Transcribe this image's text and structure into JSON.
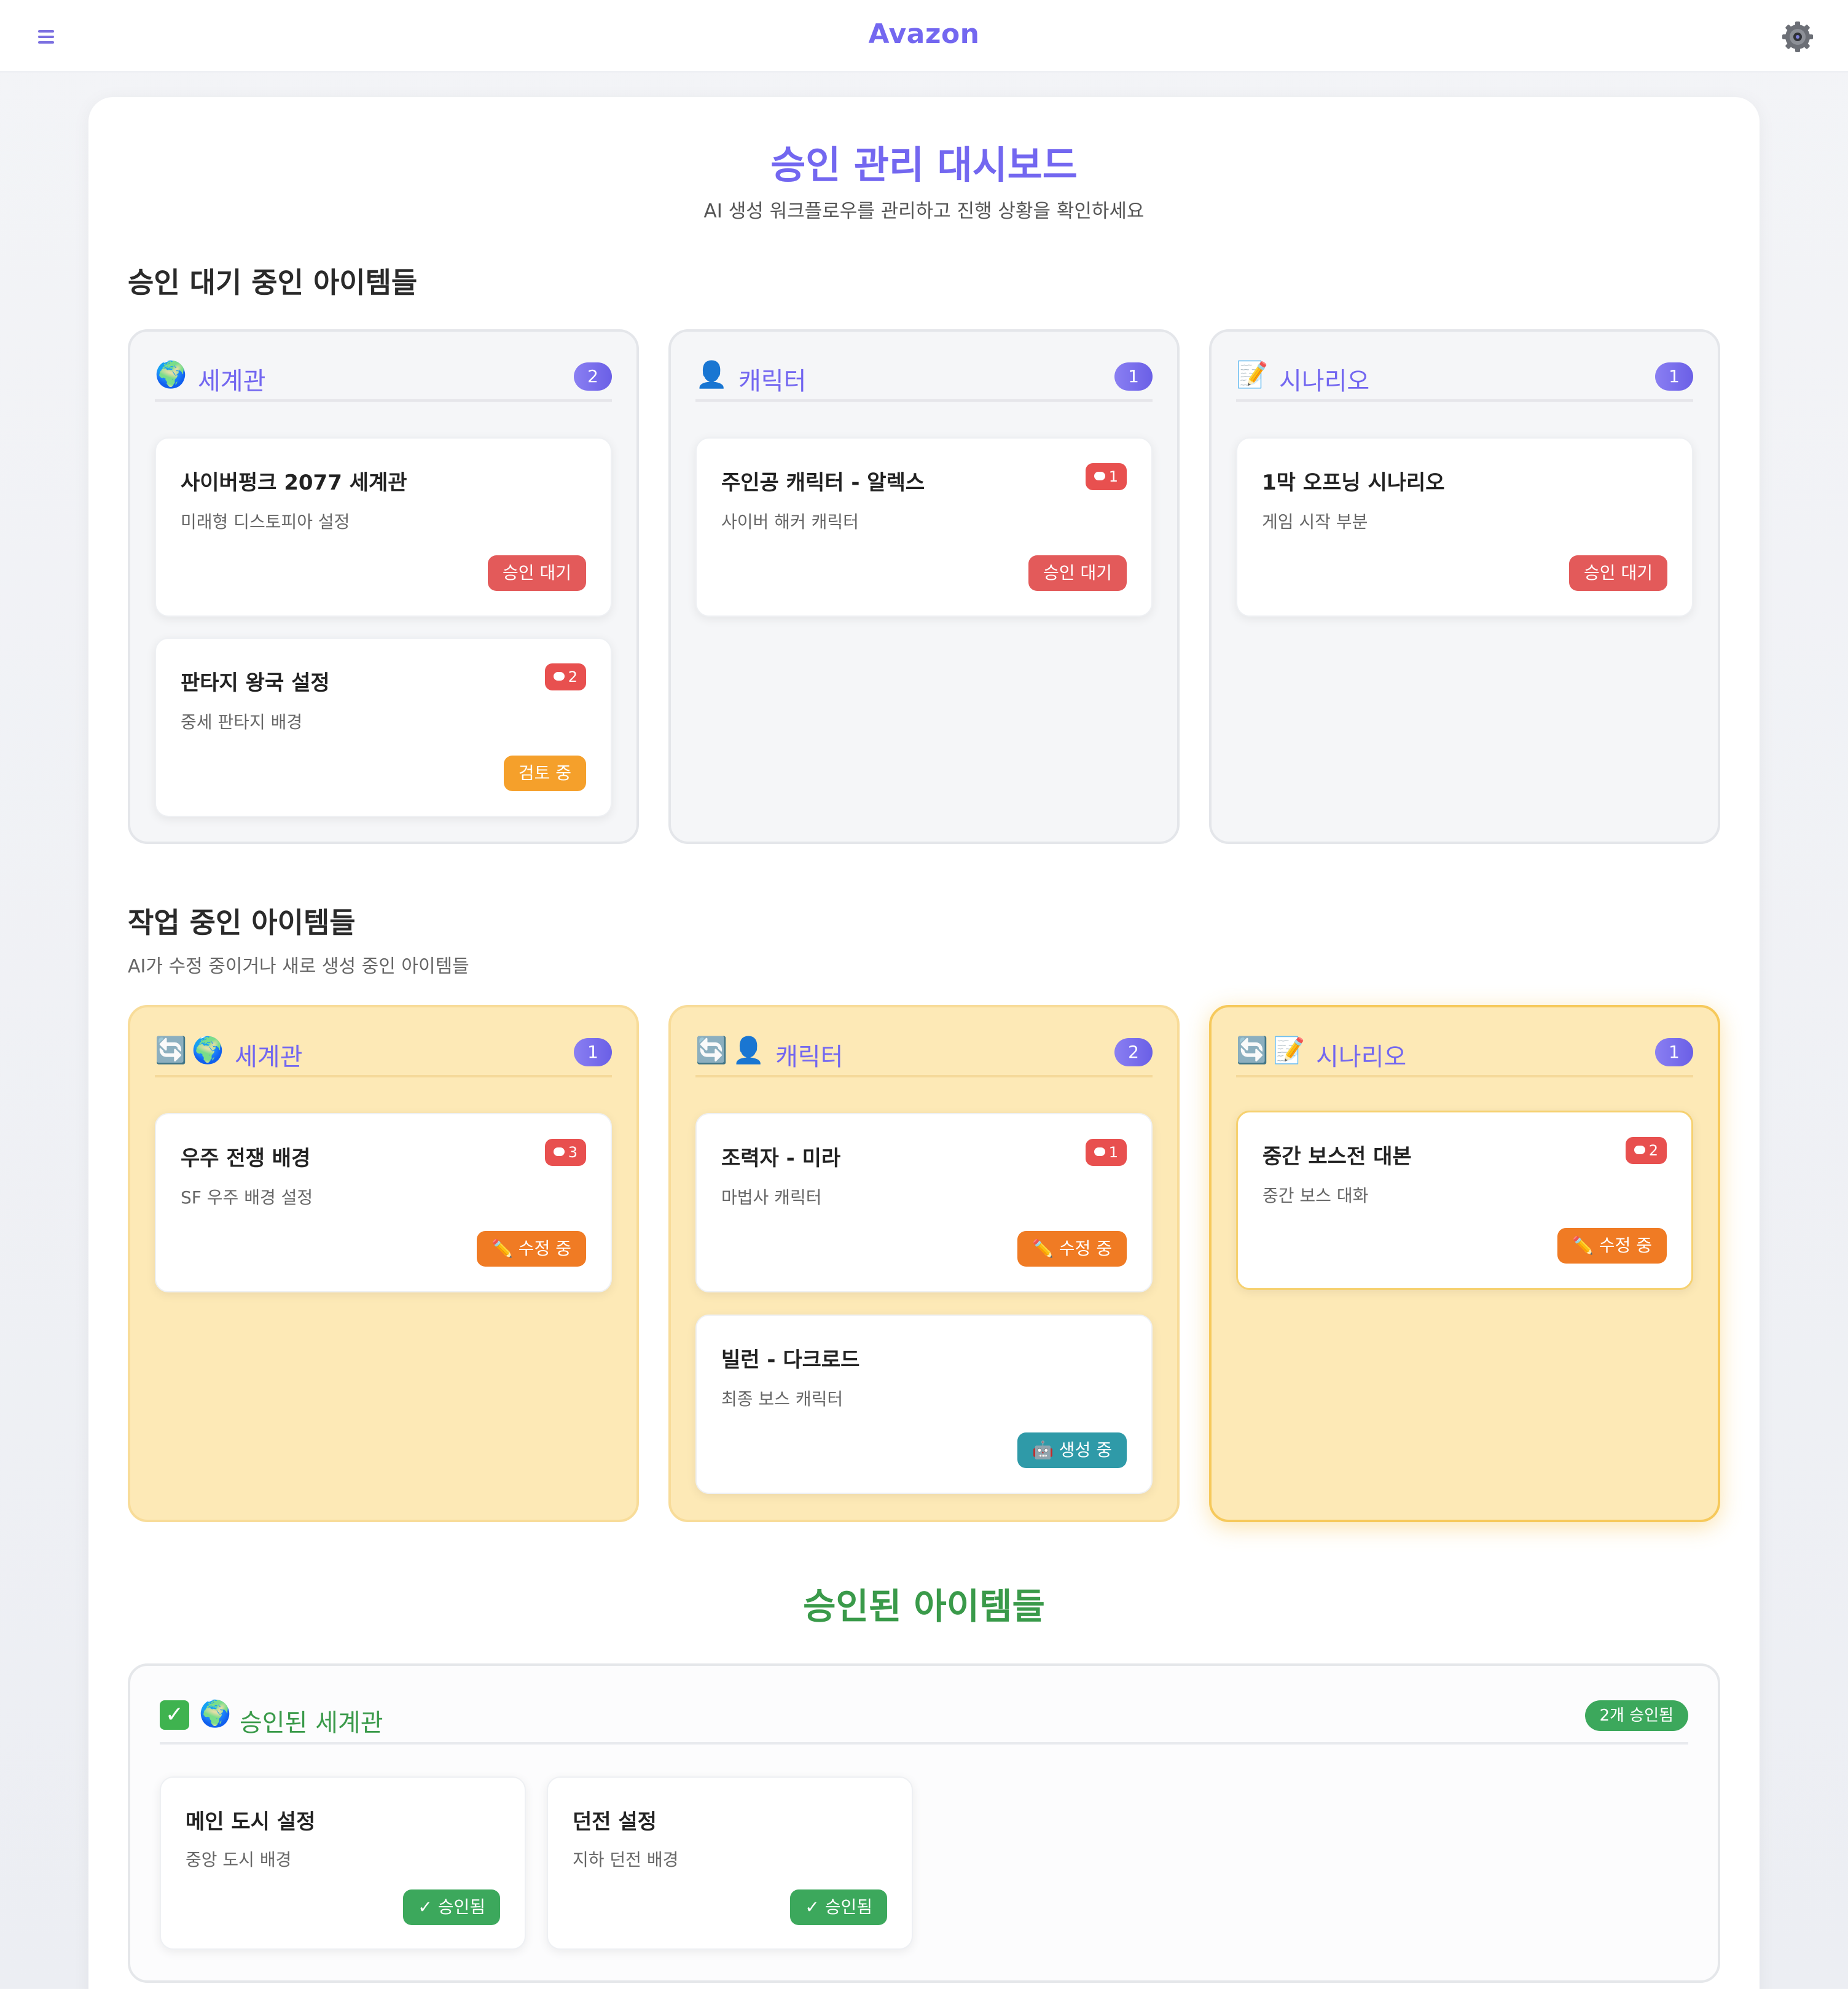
{
  "header": {
    "brand": "Avazon"
  },
  "page": {
    "title": "승인 관리 대시보드",
    "subtitle": "AI 생성 워크플로우를 관리하고 진행 상황을 확인하세요"
  },
  "pending": {
    "title": "승인 대기 중인 아이템들",
    "columns": [
      {
        "label": "세계관",
        "icon": "globe-icon",
        "count": "2",
        "items": [
          {
            "title": "사이버펑크 2077 세계관",
            "desc": "미래형 디스토피아 설정",
            "status": "승인 대기"
          },
          {
            "title": "판타지 왕국 설정",
            "desc": "중세 판타지 배경",
            "comments": "2",
            "status": "검토 중"
          }
        ]
      },
      {
        "label": "캐릭터",
        "icon": "person-icon",
        "count": "1",
        "items": [
          {
            "title": "주인공 캐릭터 - 알렉스",
            "desc": "사이버 해커 캐릭터",
            "comments": "1",
            "status": "승인 대기"
          }
        ]
      },
      {
        "label": "시나리오",
        "icon": "memo-icon",
        "count": "1",
        "items": [
          {
            "title": "1막 오프닝 시나리오",
            "desc": "게임 시작 부분",
            "status": "승인 대기"
          }
        ]
      }
    ]
  },
  "working": {
    "title": "작업 중인 아이템들",
    "subtitle": "AI가 수정 중이거나 새로 생성 중인 아이템들",
    "columns": [
      {
        "label": "세계관",
        "icon": "globe-icon",
        "count": "1",
        "items": [
          {
            "title": "우주 전쟁 배경",
            "desc": "SF 우주 배경 설정",
            "comments": "3",
            "status": "✏️ 수정 중"
          }
        ]
      },
      {
        "label": "캐릭터",
        "icon": "person-icon",
        "count": "2",
        "items": [
          {
            "title": "조력자 - 미라",
            "desc": "마법사 캐릭터",
            "comments": "1",
            "status": "✏️ 수정 중"
          },
          {
            "title": "빌런 - 다크로드",
            "desc": "최종 보스 캐릭터",
            "status": "🤖 생성 중"
          }
        ]
      },
      {
        "label": "시나리오",
        "icon": "memo-icon",
        "count": "1",
        "items": [
          {
            "title": "중간 보스전 대본",
            "desc": "중간 보스 대화",
            "comments": "2",
            "status": "✏️ 수정 중"
          }
        ]
      }
    ]
  },
  "approved": {
    "title": "승인된 아이템들",
    "group_label": "승인된 세계관",
    "group_count": "2개 승인됨",
    "items": [
      {
        "title": "메인 도시 설정",
        "desc": "중앙 도시 배경",
        "status": "✓ 승인됨"
      },
      {
        "title": "던전 설정",
        "desc": "지하 던전 배경",
        "status": "✓ 승인됨"
      }
    ]
  },
  "colors": {
    "accent": "#7367f0",
    "approved": "#3a9a4a",
    "wait": "#e35a5a",
    "review": "#f5a02b",
    "edit": "#f07b24",
    "generate": "#2f9aa8"
  }
}
